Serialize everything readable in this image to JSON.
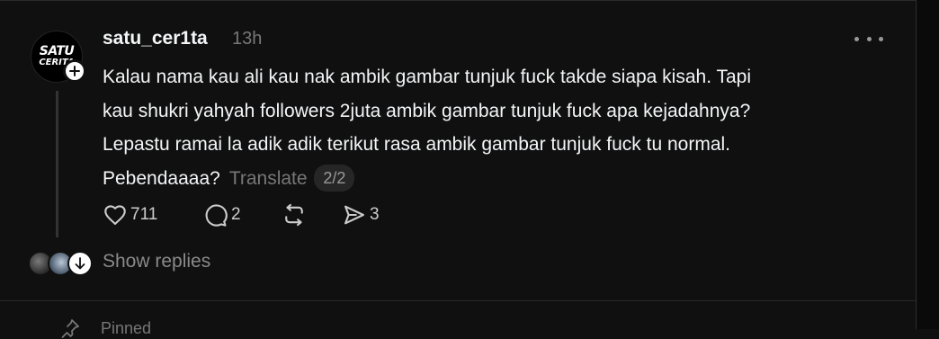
{
  "post": {
    "avatar": {
      "line1": "SATU",
      "line2": "CERITA"
    },
    "username": "satu_cer1ta",
    "time": "13h",
    "body_lines": [
      "Kalau nama kau ali kau nak ambik gambar tunjuk fuck takde siapa kisah. Tapi",
      "kau shukri yahyah followers 2juta ambik gambar tunjuk fuck apa kejadahnya?",
      "Lepastu ramai la adik adik terikut rasa ambik gambar tunjuk fuck tu normal.",
      "Pebendaaaa?"
    ],
    "translate_label": "Translate",
    "pager": "2/2",
    "likes": "711",
    "comments": "2",
    "shares": "3"
  },
  "replies": {
    "label": "Show replies"
  },
  "next_post": {
    "pinned_label": "Pinned"
  },
  "icons": {
    "more": "more-horizontal-icon",
    "like": "heart-icon",
    "comment": "comment-icon",
    "repost": "repost-icon",
    "share": "send-icon",
    "follow": "plus-icon",
    "pin": "pin-icon"
  },
  "colors": {
    "background": "#101010",
    "text": "#f3f5f7",
    "muted": "#777777"
  }
}
